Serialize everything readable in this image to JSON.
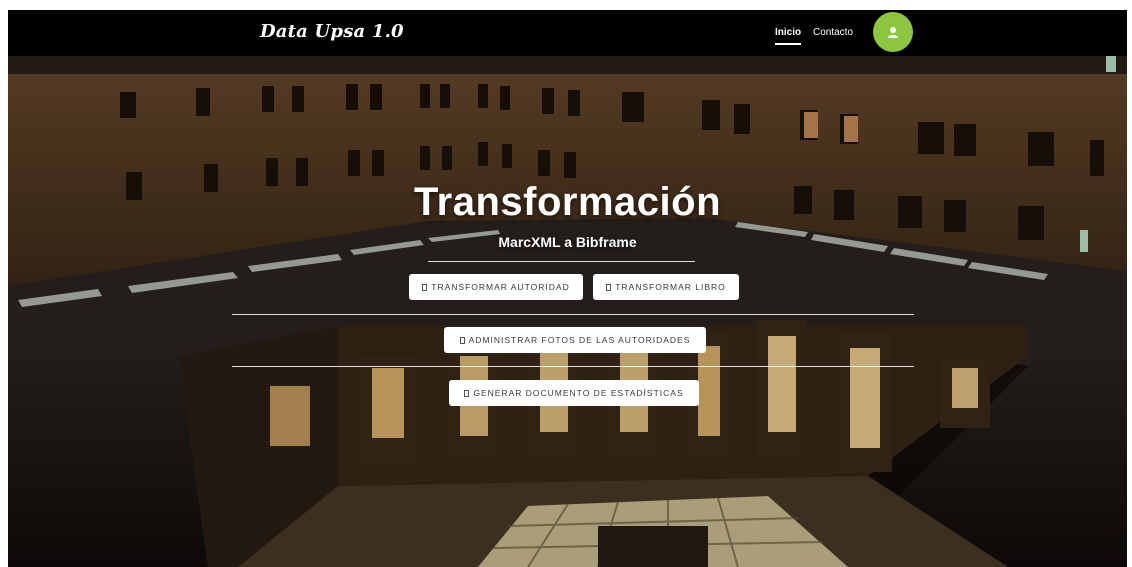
{
  "nav": {
    "brand": "Data Upsa 1.0",
    "links": [
      {
        "label": "Inicio",
        "active": true
      },
      {
        "label": "Contacto",
        "active": false
      }
    ],
    "avatar_color": "#8cc63f",
    "avatar_icon": "user-icon"
  },
  "hero": {
    "title": "Transformación",
    "subtitle": "MarcXML a Bibframe",
    "buttons": {
      "transform_authority": "TRANSFORMAR AUTORIDAD",
      "transform_book": "TRANSFORMAR LIBRO",
      "manage_photos": "ADMINISTRAR FOTOS DE LAS AUTORIDADES",
      "generate_stats": "GENERAR DOCUMENTO DE ESTADÍSTICAS"
    },
    "button_icon": "square-icon",
    "background": "night courtyard building photo"
  }
}
